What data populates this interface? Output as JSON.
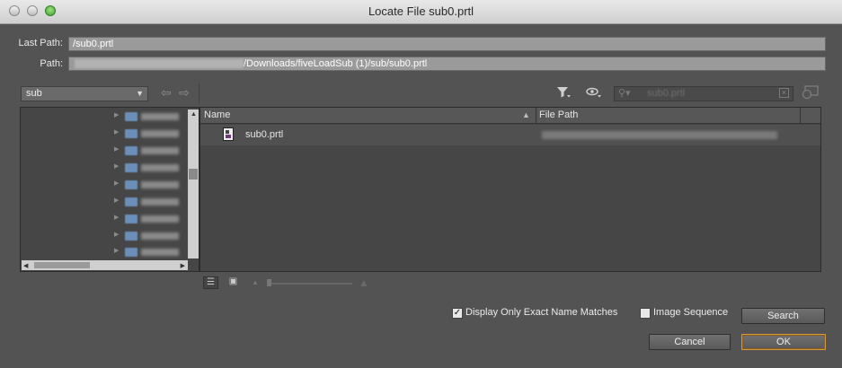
{
  "window": {
    "title": "Locate File sub0.prtl"
  },
  "fields": {
    "last_path_label": "Last Path:",
    "last_path_value": "/sub0.prtl",
    "path_label": "Path:",
    "path_value": "/Downloads/fiveLoadSub (1)/sub/sub0.prtl"
  },
  "folder_dropdown": {
    "selected": "sub"
  },
  "search": {
    "placeholder": "sub0.prtl"
  },
  "file_list": {
    "columns": [
      "Name",
      "File Path"
    ],
    "rows": [
      {
        "name": "sub0.prtl"
      }
    ]
  },
  "options": {
    "exact_match_label": "Display Only Exact Name Matches",
    "exact_match_checked": true,
    "image_sequence_label": "Image Sequence",
    "image_sequence_checked": false
  },
  "buttons": {
    "search": "Search",
    "cancel": "Cancel",
    "ok": "OK"
  },
  "colors": {
    "default_button_border": "#d99a3c",
    "dialog_bg": "#535353"
  },
  "icons": [
    "filter-icon",
    "eye-icon",
    "search-icon",
    "clear-search-icon",
    "path-icon",
    "back-arrow-icon",
    "forward-arrow-icon",
    "list-view-icon",
    "icon-view-icon",
    "file-icon",
    "folder-icon"
  ]
}
